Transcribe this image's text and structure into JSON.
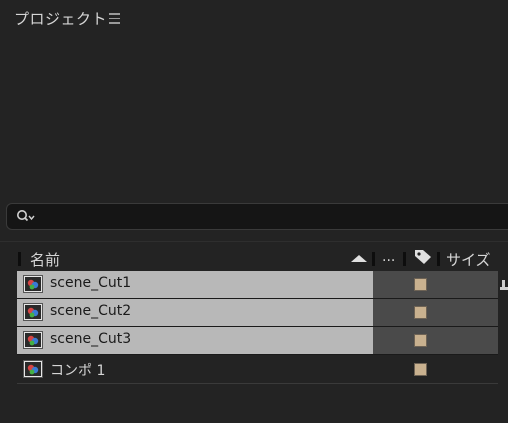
{
  "panel": {
    "title": "プロジェクト"
  },
  "search": {
    "value": "",
    "placeholder": ""
  },
  "columns": {
    "name": "名前",
    "more": "...",
    "size": "サイズ"
  },
  "items": [
    {
      "label": "scene_Cut1",
      "selected": true,
      "label_color": "#c9b18f"
    },
    {
      "label": "scene_Cut2",
      "selected": true,
      "label_color": "#c9b18f"
    },
    {
      "label": "scene_Cut3",
      "selected": true,
      "label_color": "#c9b18f"
    },
    {
      "label": "コンポ 1",
      "selected": false,
      "label_color": "#c9b18f"
    }
  ],
  "colors": {
    "panel_bg": "#232323",
    "selected_row": "#b8b8b8",
    "selected_mid": "#4a4a4a",
    "label_swatch": "#c9b18f"
  }
}
